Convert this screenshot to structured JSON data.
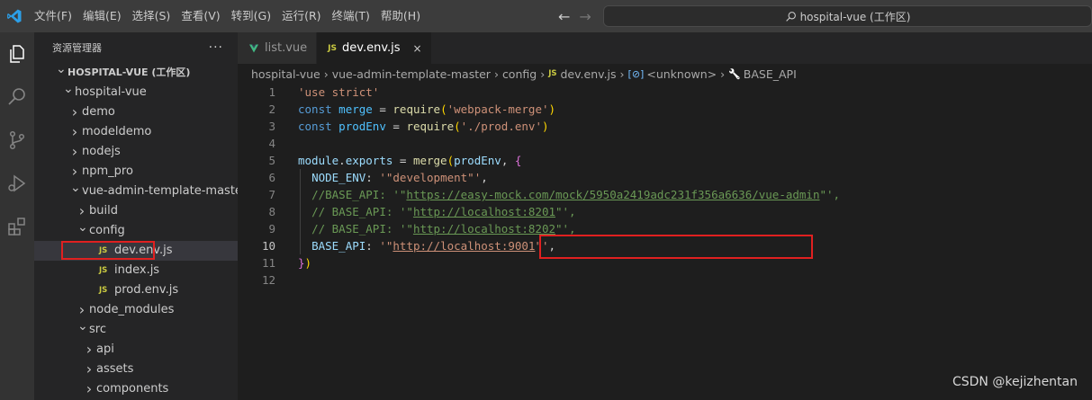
{
  "menu": [
    "文件(F)",
    "编辑(E)",
    "选择(S)",
    "查看(V)",
    "转到(G)",
    "运行(R)",
    "终端(T)",
    "帮助(H)"
  ],
  "search": {
    "text": "hospital-vue (工作区)"
  },
  "sidebar": {
    "title": "资源管理器",
    "more": "···",
    "tree": [
      {
        "label": "HOSPITAL-VUE (工作区)",
        "depth": 0,
        "kind": "root"
      },
      {
        "label": "hospital-vue",
        "depth": 1,
        "kind": "open"
      },
      {
        "label": "demo",
        "depth": 2,
        "kind": "closed"
      },
      {
        "label": "modeldemo",
        "depth": 2,
        "kind": "closed"
      },
      {
        "label": "nodejs",
        "depth": 2,
        "kind": "closed"
      },
      {
        "label": "npm_pro",
        "depth": 2,
        "kind": "closed"
      },
      {
        "label": "vue-admin-template-master",
        "depth": 2,
        "kind": "open"
      },
      {
        "label": "build",
        "depth": 3,
        "kind": "closed"
      },
      {
        "label": "config",
        "depth": 3,
        "kind": "open"
      },
      {
        "label": "dev.env.js",
        "depth": 4,
        "kind": "js",
        "selected": true
      },
      {
        "label": "index.js",
        "depth": 4,
        "kind": "js"
      },
      {
        "label": "prod.env.js",
        "depth": 4,
        "kind": "js"
      },
      {
        "label": "node_modules",
        "depth": 3,
        "kind": "closed"
      },
      {
        "label": "src",
        "depth": 3,
        "kind": "open"
      },
      {
        "label": "api",
        "depth": 4,
        "kind": "closed"
      },
      {
        "label": "assets",
        "depth": 4,
        "kind": "closed"
      },
      {
        "label": "components",
        "depth": 4,
        "kind": "closed"
      }
    ]
  },
  "tabs": [
    {
      "label": "list.vue",
      "icon": "vue-icon",
      "active": false
    },
    {
      "label": "dev.env.js",
      "icon": "js-icon",
      "active": true,
      "close": "×"
    }
  ],
  "js_badge": "JS",
  "breadcrumb": [
    "hospital-vue",
    "vue-admin-template-master",
    "config",
    "dev.env.js",
    "<unknown>",
    "BASE_API"
  ],
  "editor": {
    "current_line": 10,
    "lines": [
      {
        "n": "1",
        "tokens": [
          [
            "s",
            "'use strict'"
          ]
        ]
      },
      {
        "n": "2",
        "tokens": [
          [
            "k",
            "const"
          ],
          [
            "p",
            " "
          ],
          [
            "c",
            "merge"
          ],
          [
            "p",
            " = "
          ],
          [
            "f",
            "require"
          ],
          [
            "b1",
            "("
          ],
          [
            "s",
            "'webpack-merge'"
          ],
          [
            "b1",
            ")"
          ]
        ]
      },
      {
        "n": "3",
        "tokens": [
          [
            "k",
            "const"
          ],
          [
            "p",
            " "
          ],
          [
            "c",
            "prodEnv"
          ],
          [
            "p",
            " = "
          ],
          [
            "f",
            "require"
          ],
          [
            "b1",
            "("
          ],
          [
            "s",
            "'./prod.env'"
          ],
          [
            "b1",
            ")"
          ]
        ]
      },
      {
        "n": "4",
        "tokens": []
      },
      {
        "n": "5",
        "tokens": [
          [
            "v",
            "module"
          ],
          [
            "p",
            "."
          ],
          [
            "v",
            "exports"
          ],
          [
            "p",
            " = "
          ],
          [
            "f",
            "merge"
          ],
          [
            "b1",
            "("
          ],
          [
            "v",
            "prodEnv"
          ],
          [
            "p",
            ", "
          ],
          [
            "b2",
            "{"
          ]
        ]
      },
      {
        "n": "6",
        "guide": true,
        "tokens": [
          [
            "p",
            "  "
          ],
          [
            "v",
            "NODE_ENV"
          ],
          [
            "p",
            ": "
          ],
          [
            "s",
            "'\"development\"'"
          ],
          [
            "p",
            ","
          ]
        ]
      },
      {
        "n": "7",
        "guide": true,
        "tokens": [
          [
            "p",
            "  "
          ],
          [
            "cm",
            "//BASE_API: '\""
          ],
          [
            "cm u",
            "https://easy-mock.com/mock/5950a2419adc231f356a6636/vue-admin"
          ],
          [
            "cm",
            "\"',"
          ]
        ]
      },
      {
        "n": "8",
        "guide": true,
        "tokens": [
          [
            "p",
            "  "
          ],
          [
            "cm",
            "// BASE_API: '\""
          ],
          [
            "cm u",
            "http://localhost:8201"
          ],
          [
            "cm",
            "\"',"
          ]
        ]
      },
      {
        "n": "9",
        "guide": true,
        "tokens": [
          [
            "p",
            "  "
          ],
          [
            "cm",
            "// BASE_API: '\""
          ],
          [
            "cm u",
            "http://localhost:8202"
          ],
          [
            "cm",
            "\"',"
          ]
        ]
      },
      {
        "n": "10",
        "guide": true,
        "tokens": [
          [
            "p",
            "  "
          ],
          [
            "v",
            "BASE_API"
          ],
          [
            "p",
            ": "
          ],
          [
            "s",
            "'\""
          ],
          [
            "s u",
            "http://localhost:9001"
          ],
          [
            "s",
            "\"'"
          ],
          [
            "p",
            ","
          ]
        ]
      },
      {
        "n": "11",
        "tokens": [
          [
            "b2",
            "}"
          ],
          [
            "b1",
            ")"
          ]
        ]
      },
      {
        "n": "12",
        "tokens": []
      }
    ]
  },
  "watermark": "CSDN @kejizhentan",
  "colors": {
    "highlight": "#e02020",
    "titlebar": "#3c3c3c",
    "sidebar": "#252526",
    "editor": "#1e1e1e"
  }
}
